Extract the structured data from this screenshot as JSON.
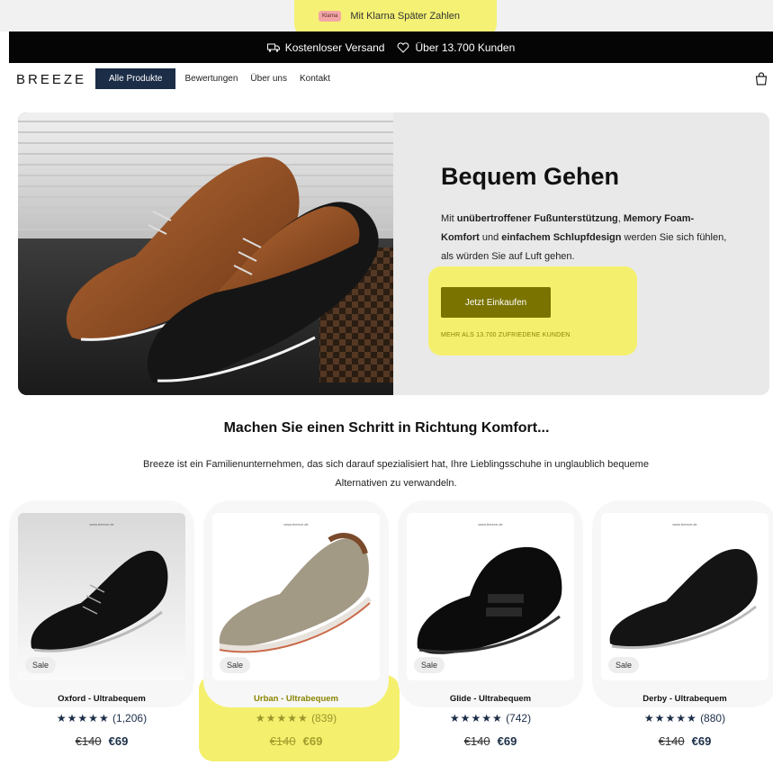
{
  "promo": {
    "badge": "Klarna",
    "text": "Mit Klarna Später Zahlen"
  },
  "shipping": {
    "free_shipping": "Kostenloser Versand",
    "customers": "Über 13.700 Kunden"
  },
  "nav": {
    "logo": "BREEZE",
    "links": [
      "Alle Produkte",
      "Bewertungen",
      "Über uns",
      "Kontakt"
    ],
    "active_index": 0
  },
  "hero": {
    "title": "Bequem Gehen",
    "desc_parts": [
      "Mit ",
      "unübertroffener Fußunterstützung",
      ", ",
      "Memory Foam-Komfort",
      " und ",
      "einfachem Schlupfdesign",
      " werden Sie sich fühlen, als würden Sie auf Luft gehen."
    ],
    "cta": "Jetzt Einkaufen",
    "cta_sub": "MEHR ALS 13.700 ZUFRIEDENE KUNDEN"
  },
  "section": {
    "heading": "Machen Sie einen Schritt in Richtung Komfort...",
    "text": "Breeze ist ein Familienunternehmen, das sich darauf spezialisiert hat, Ihre Lieblingsschuhe in unglaublich bequeme Alternativen zu verwandeln."
  },
  "products": [
    {
      "title": "Oxford - Ultrabequem",
      "stars": "★★★★★",
      "reviews": "(1,206)",
      "old_price": "€140",
      "price": "€69",
      "badge": "Sale",
      "brand": "www.breeze.de"
    },
    {
      "title": "Urban - Ultrabequem",
      "stars": "★★★★★",
      "reviews": "(839)",
      "old_price": "€140",
      "price": "€69",
      "badge": "Sale",
      "brand": "www.breeze.de"
    },
    {
      "title": "Glide - Ultrabequem",
      "stars": "★★★★★",
      "reviews": "(742)",
      "old_price": "€140",
      "price": "€69",
      "badge": "Sale",
      "brand": "www.breeze.de"
    },
    {
      "title": "Derby - Ultrabequem",
      "stars": "★★★★★",
      "reviews": "(880)",
      "old_price": "€140",
      "price": "€69",
      "badge": "Sale",
      "brand": "www.breeze.de"
    }
  ],
  "colors": {
    "navy": "#1b2d47",
    "olive": "#7a7300",
    "highlight": "#f4f06d"
  },
  "icons": [
    "truck-icon",
    "heart-icon",
    "cart-icon",
    "star-icon"
  ]
}
